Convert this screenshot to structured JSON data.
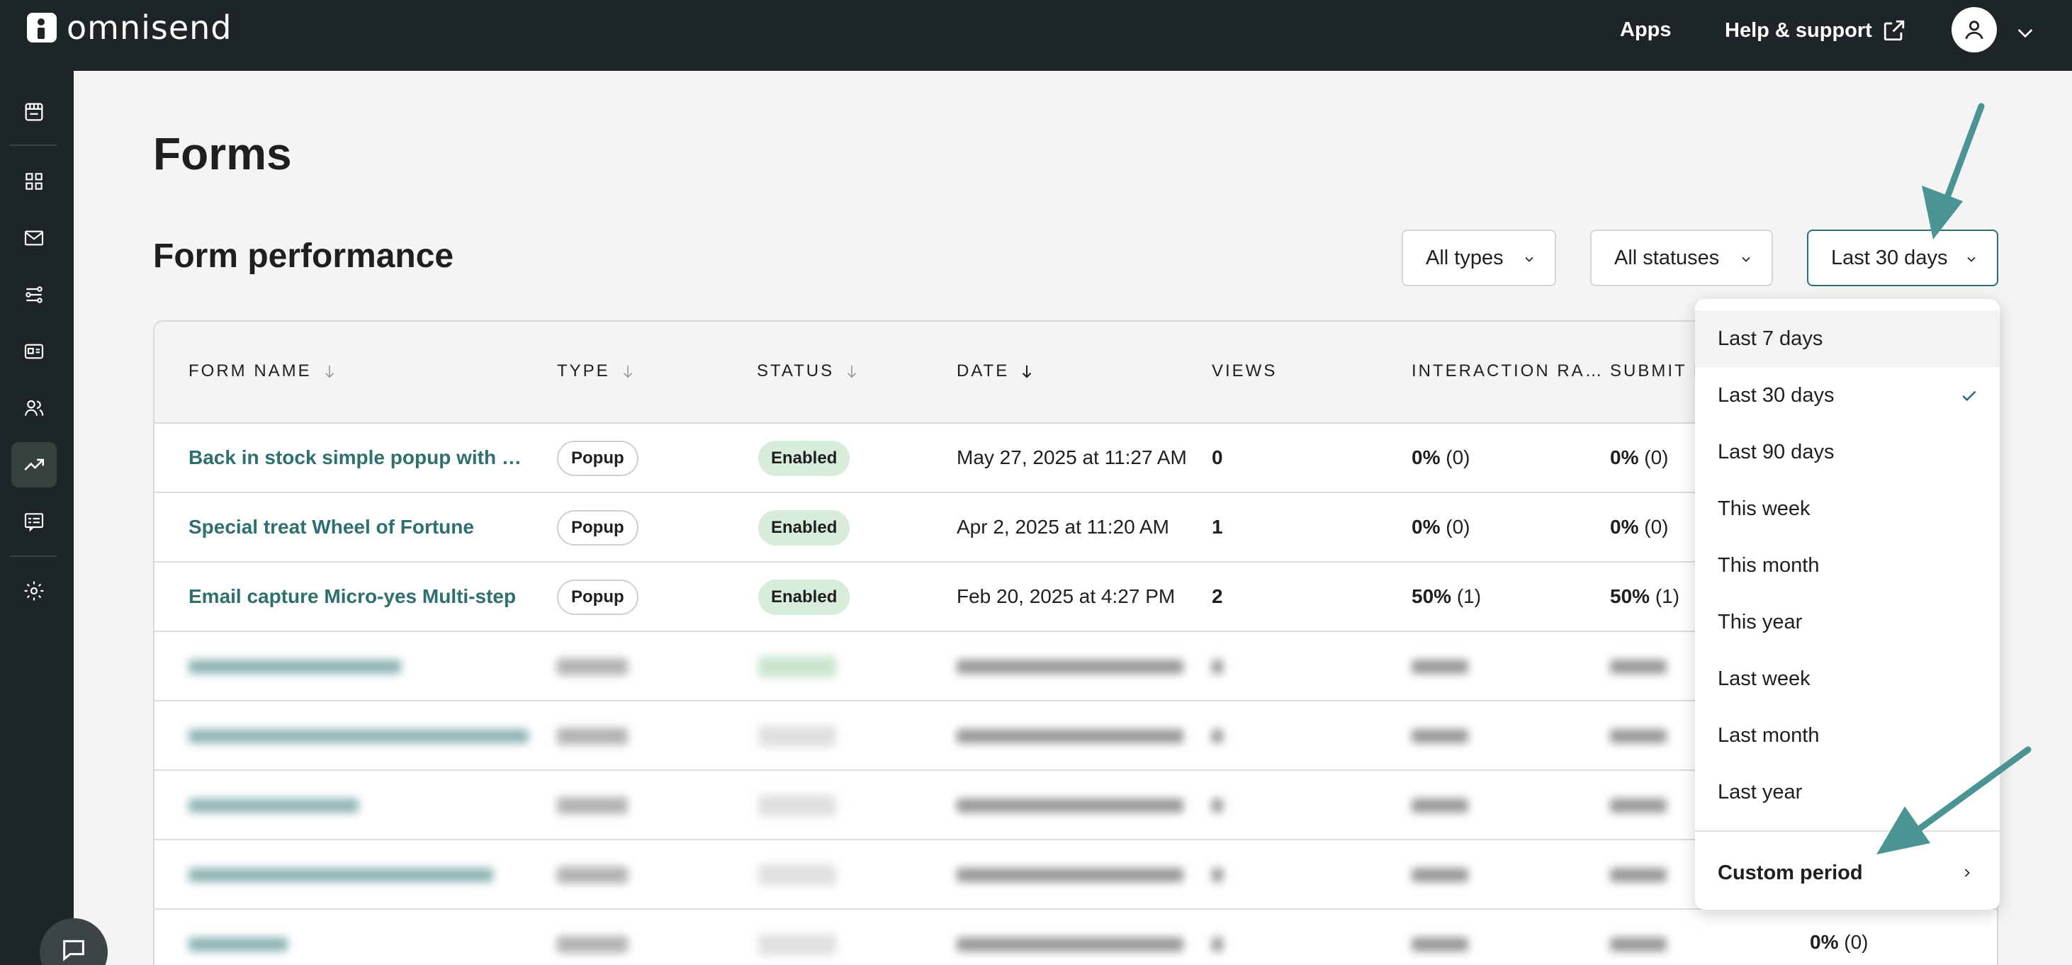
{
  "brand": {
    "name": "omnisend"
  },
  "topbar": {
    "apps": "Apps",
    "help": "Help & support"
  },
  "page": {
    "title": "Forms",
    "section_title": "Form performance"
  },
  "filters": {
    "types": "All types",
    "statuses": "All statuses",
    "period": "Last 30 days"
  },
  "table": {
    "headers": {
      "form_name": "FORM NAME",
      "type": "TYPE",
      "status": "STATUS",
      "date": "DATE",
      "views": "VIEWS",
      "interaction_rate": "INTERACTION RA…",
      "submit_rate": "SUBMIT R"
    },
    "rows": [
      {
        "name": "Back in stock simple popup with Tea…",
        "type": "Popup",
        "status": "Enabled",
        "date": "May 27, 2025 at 11:27 AM",
        "views": "0",
        "interaction_pct": "0%",
        "interaction_count": "(0)",
        "submit_pct": "0%",
        "submit_count": "(0)"
      },
      {
        "name": "Special treat Wheel of Fortune",
        "type": "Popup",
        "status": "Enabled",
        "date": "Apr 2, 2025 at 11:20 AM",
        "views": "1",
        "interaction_pct": "0%",
        "interaction_count": "(0)",
        "submit_pct": "0%",
        "submit_count": "(0)"
      },
      {
        "name": "Email capture Micro-yes Multi-step",
        "type": "Popup",
        "status": "Enabled",
        "date": "Feb 20, 2025 at 4:27 PM",
        "views": "2",
        "interaction_pct": "50%",
        "interaction_count": "(1)",
        "submit_pct": "50%",
        "submit_count": "(1)"
      }
    ],
    "last_row_visible_value": {
      "pct": "0%",
      "count": "(0)"
    }
  },
  "dropdown": {
    "options": [
      {
        "label": "Last 7 days",
        "hovered": true,
        "selected": false
      },
      {
        "label": "Last 30 days",
        "hovered": false,
        "selected": true
      },
      {
        "label": "Last 90 days",
        "hovered": false,
        "selected": false
      },
      {
        "label": "This week",
        "hovered": false,
        "selected": false
      },
      {
        "label": "This month",
        "hovered": false,
        "selected": false
      },
      {
        "label": "This year",
        "hovered": false,
        "selected": false
      },
      {
        "label": "Last week",
        "hovered": false,
        "selected": false
      },
      {
        "label": "Last month",
        "hovered": false,
        "selected": false
      },
      {
        "label": "Last year",
        "hovered": false,
        "selected": false
      }
    ],
    "custom": "Custom period"
  },
  "colors": {
    "topbar": "#1d2526",
    "accent": "#2e6f70",
    "arrow": "#4a9593",
    "enabled_badge": "#d7ecd9"
  },
  "icons": [
    "store-icon",
    "dashboard-icon",
    "mail-icon",
    "automation-icon",
    "campaign-icon",
    "audience-icon",
    "analytics-icon",
    "forms-icon",
    "settings-icon",
    "chat-icon",
    "external-link-icon",
    "user-icon",
    "chevron-down-icon",
    "sort-arrow-icon",
    "check-icon",
    "chevron-right-icon"
  ]
}
